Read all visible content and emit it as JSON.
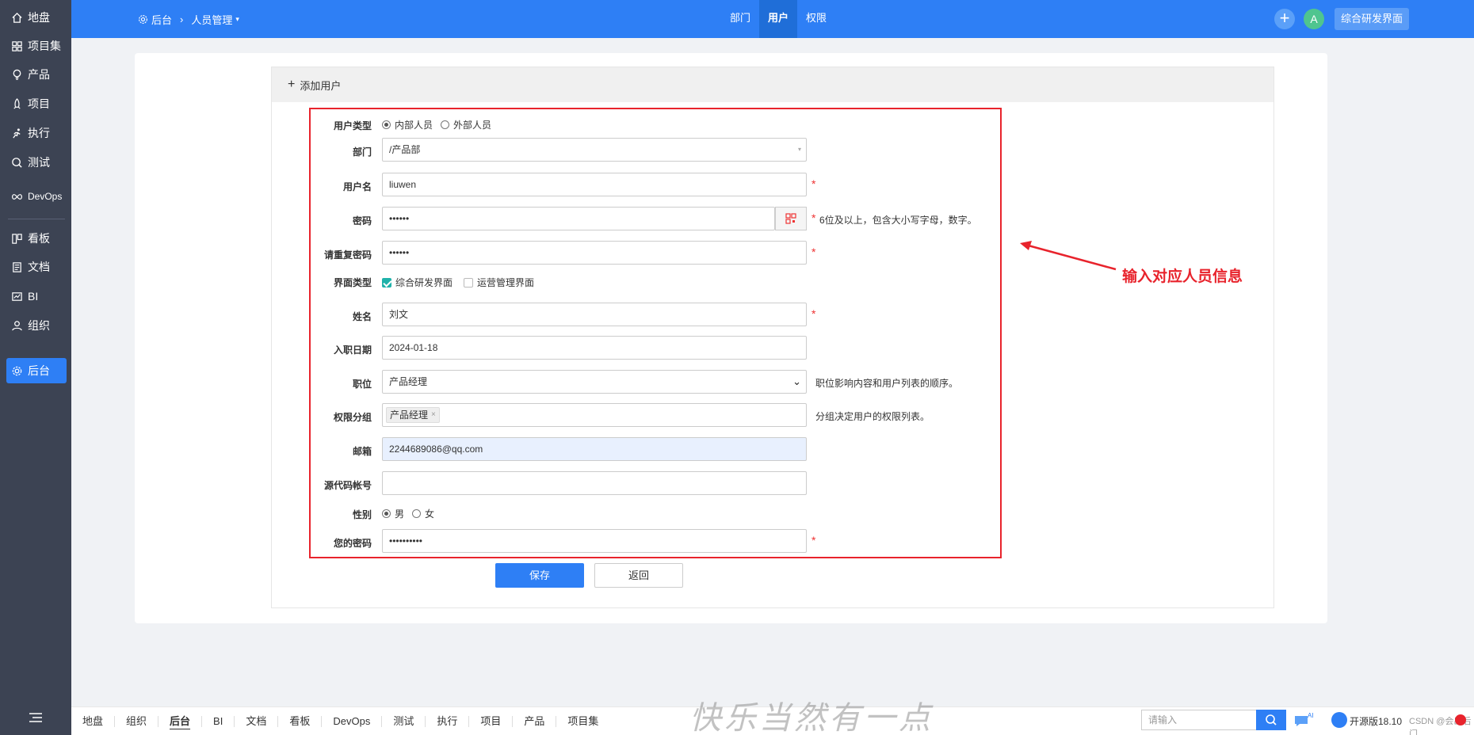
{
  "sidebar": {
    "items": [
      {
        "label": "地盘",
        "icon": "home-icon"
      },
      {
        "label": "项目集",
        "icon": "grid-icon"
      },
      {
        "label": "产品",
        "icon": "lightbulb-icon"
      },
      {
        "label": "项目",
        "icon": "rocket-icon"
      },
      {
        "label": "执行",
        "icon": "run-icon"
      },
      {
        "label": "测试",
        "icon": "test-icon"
      },
      {
        "label": "DevOps",
        "icon": "infinity-icon"
      },
      {
        "label": "看板",
        "icon": "kanban-icon"
      },
      {
        "label": "文档",
        "icon": "doc-icon"
      },
      {
        "label": "BI",
        "icon": "chart-icon"
      },
      {
        "label": "组织",
        "icon": "people-icon"
      },
      {
        "label": "后台",
        "icon": "gear-icon"
      }
    ],
    "active": "后台"
  },
  "header": {
    "breadcrumb": [
      "后台",
      "人员管理"
    ],
    "nav": [
      "部门",
      "用户",
      "权限"
    ],
    "active_nav": "用户",
    "avatar": "A",
    "view_switch": "综合研发界面"
  },
  "form": {
    "title": "添加用户",
    "user_type": {
      "label": "用户类型",
      "options": [
        "内部人员",
        "外部人员"
      ],
      "selected": "内部人员"
    },
    "dept": {
      "label": "部门",
      "value": "/产品部"
    },
    "username": {
      "label": "用户名",
      "value": "liuwen"
    },
    "password": {
      "label": "密码",
      "value": "••••••",
      "help": "6位及以上，包含大小写字母，数字。"
    },
    "password2": {
      "label": "请重复密码",
      "value": "••••••"
    },
    "ui_type": {
      "label": "界面类型",
      "options": [
        "综合研发界面",
        "运营管理界面"
      ],
      "checked": [
        "综合研发界面"
      ]
    },
    "realname": {
      "label": "姓名",
      "value": "刘文"
    },
    "join_date": {
      "label": "入职日期",
      "value": "2024-01-18"
    },
    "role": {
      "label": "职位",
      "value": "产品经理",
      "help": "职位影响内容和用户列表的顺序。"
    },
    "group": {
      "label": "权限分组",
      "tag": "产品经理",
      "help": "分组决定用户的权限列表。"
    },
    "email": {
      "label": "邮箱",
      "value": "2244689086@qq.com"
    },
    "commiter": {
      "label": "源代码帐号",
      "value": ""
    },
    "gender": {
      "label": "性别",
      "options": [
        "男",
        "女"
      ],
      "selected": "男"
    },
    "verify": {
      "label": "您的密码",
      "value": "••••••••••"
    },
    "save": "保存",
    "back": "返回"
  },
  "annotation": "输入对应人员信息",
  "footer": {
    "nav": [
      "地盘",
      "组织",
      "后台",
      "BI",
      "文档",
      "看板",
      "DevOps",
      "测试",
      "执行",
      "项目",
      "产品",
      "项目集"
    ],
    "active": "后台",
    "search_placeholder": "请输入",
    "version": "开源版18.10",
    "credit": "CSDN @会出后门"
  },
  "watermark": "快乐当然有一点",
  "colors": {
    "primary": "#2e7ff5",
    "sidebar": "#3c4353",
    "annotation": "#e8232c"
  }
}
